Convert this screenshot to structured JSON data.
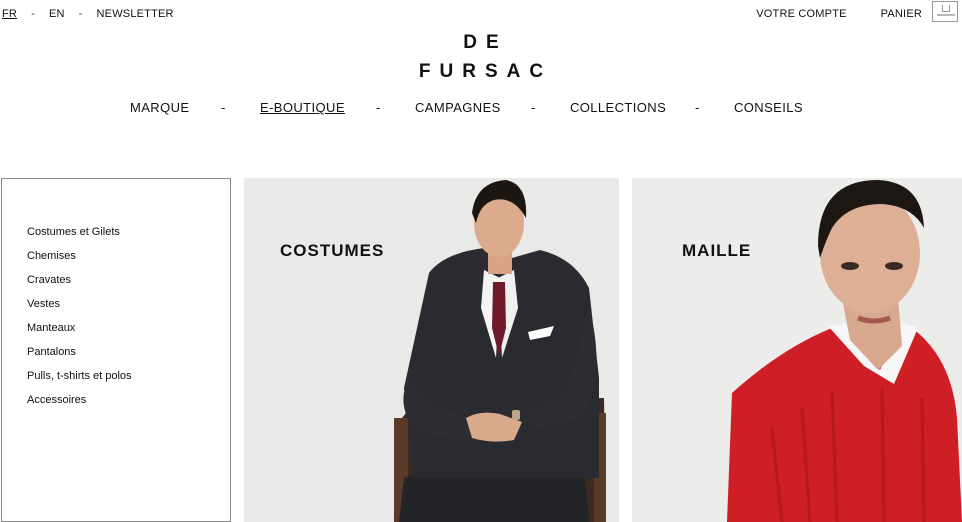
{
  "topbar": {
    "lang_fr": "FR",
    "lang_sep": "-",
    "lang_en": "EN",
    "newsletter": "NEWSLETTER",
    "account": "VOTRE COMPTE",
    "cart": "PANIER",
    "cart_icon": "shopping-bag-icon"
  },
  "logo": {
    "line1": "DE",
    "line2": "FURSAC"
  },
  "nav": {
    "items": [
      "MARQUE",
      "E-BOUTIQUE",
      "CAMPAGNES",
      "COLLECTIONS",
      "CONSEILS"
    ],
    "separator": "-",
    "active": "E-BOUTIQUE"
  },
  "sidebar": {
    "items": [
      "Costumes et Gilets",
      "Chemises",
      "Cravates",
      "Vestes",
      "Manteaux",
      "Pantalons",
      "Pulls, t-shirts et polos",
      "Accessoires"
    ]
  },
  "cards": [
    {
      "title": "COSTUMES"
    },
    {
      "title": "MAILLE"
    }
  ],
  "colors": {
    "text": "#111111",
    "suit": "#2a2b30",
    "tie": "#6d1b2a",
    "sweater": "#cf1f26",
    "card_bg": "#e9e9e7"
  }
}
